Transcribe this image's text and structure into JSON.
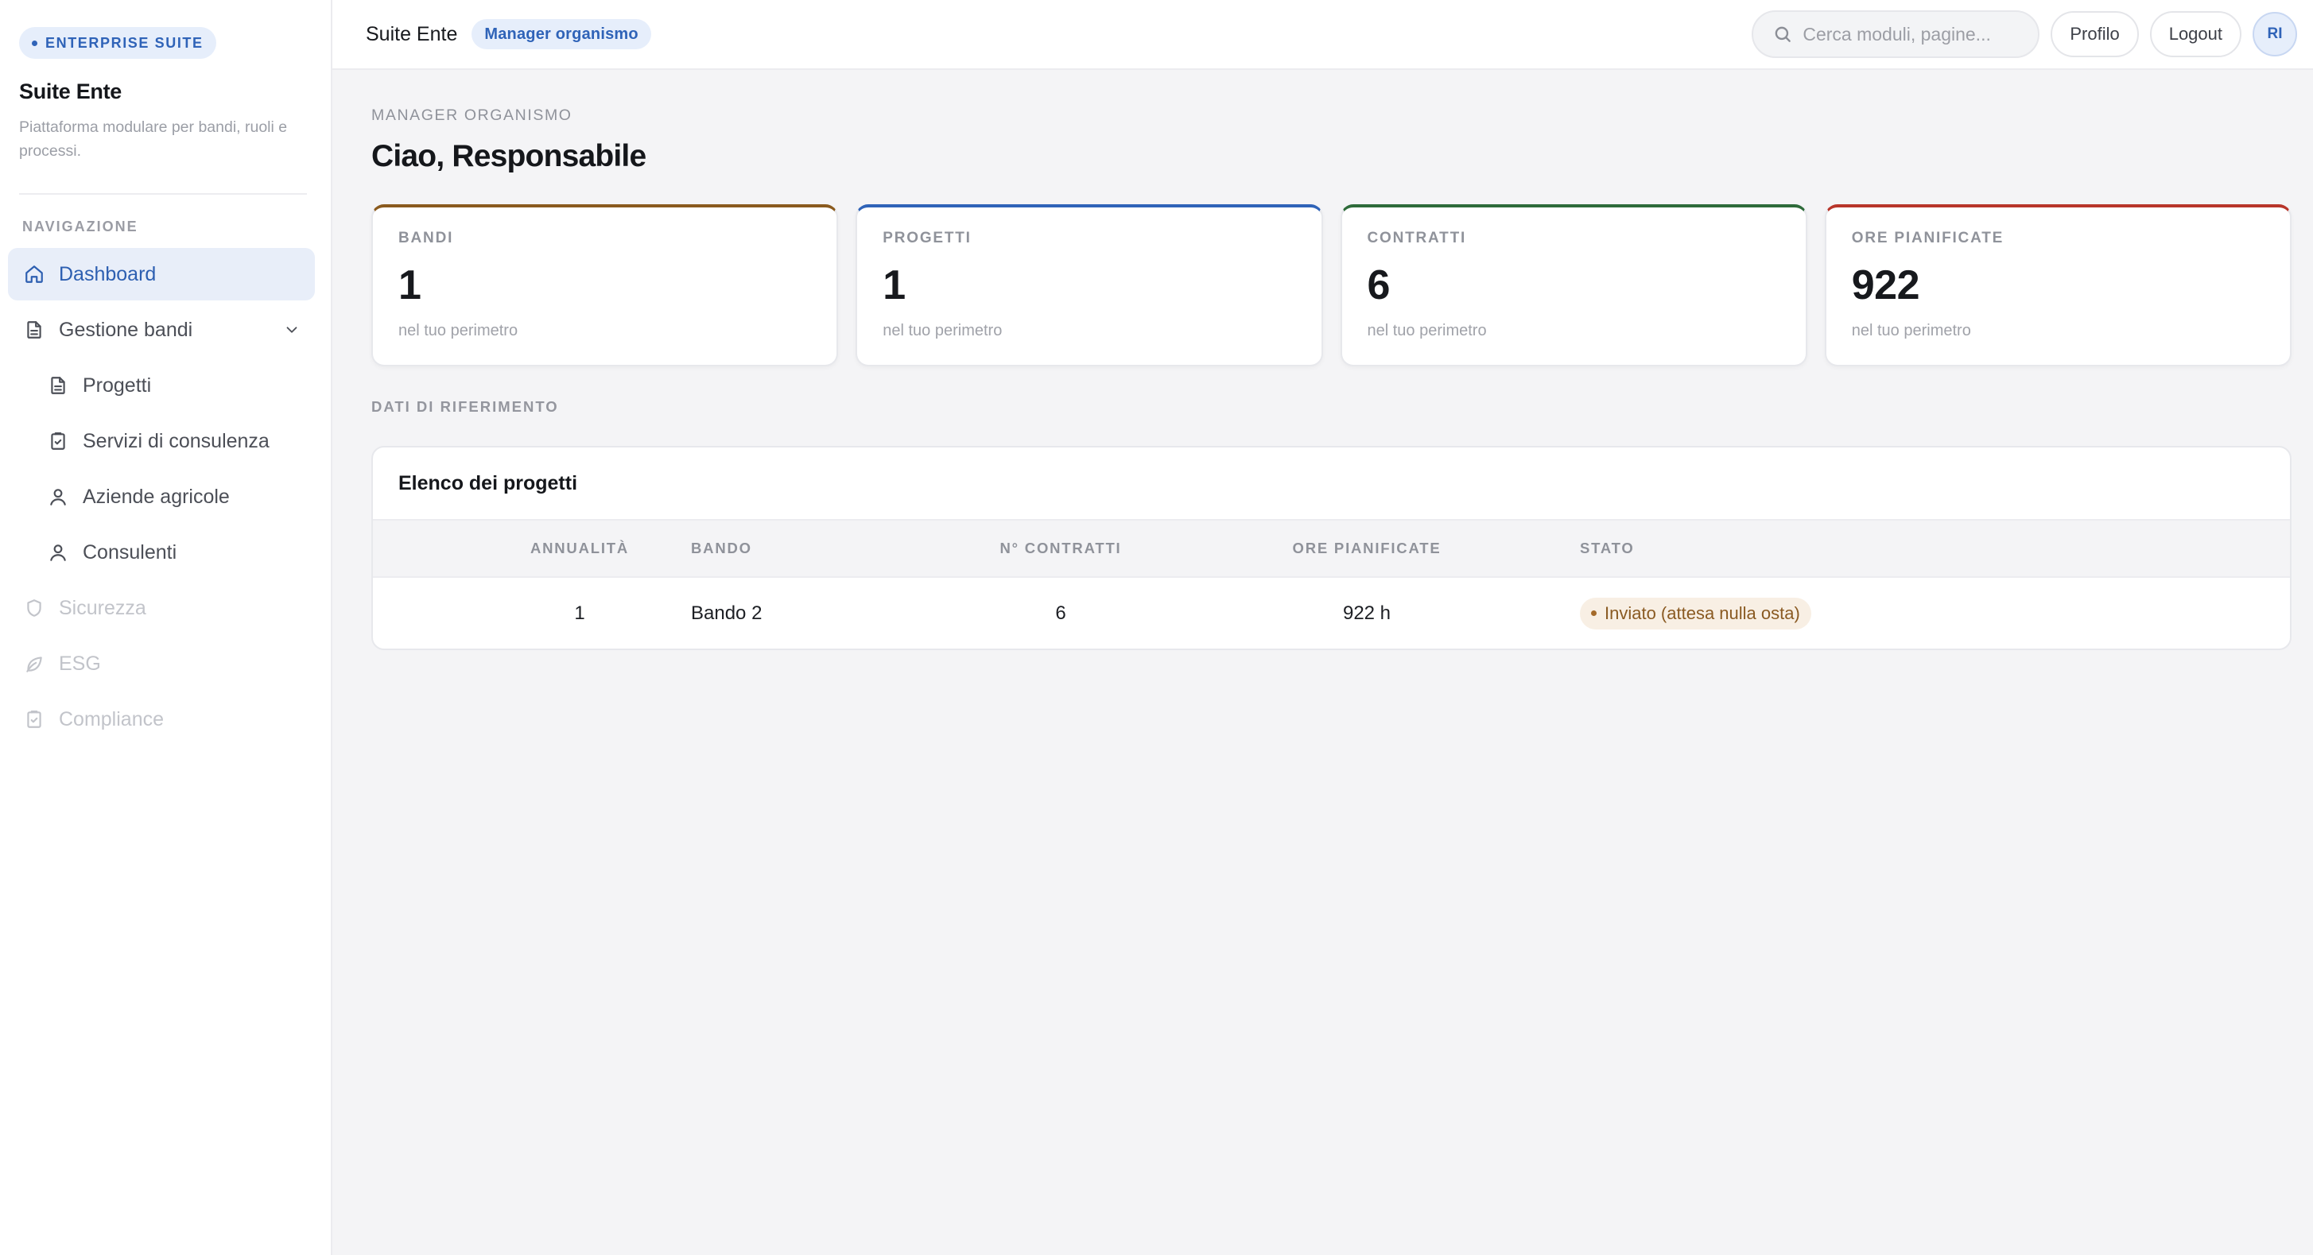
{
  "sidebar": {
    "suite_chip": "ENTERPRISE SUITE",
    "brand_title": "Suite Ente",
    "brand_desc": "Piattaforma modulare per bandi, ruoli e processi.",
    "nav_caption": "NAVIGAZIONE",
    "items": [
      {
        "label": "Dashboard",
        "icon": "home-icon",
        "state": "active"
      },
      {
        "label": "Gestione bandi",
        "icon": "document-icon",
        "state": "expanded"
      },
      {
        "label": "Progetti",
        "icon": "document-icon",
        "state": "sub"
      },
      {
        "label": "Servizi di consulenza",
        "icon": "clipboard-icon",
        "state": "sub"
      },
      {
        "label": "Aziende agricole",
        "icon": "user-icon",
        "state": "sub"
      },
      {
        "label": "Consulenti",
        "icon": "user-icon",
        "state": "sub"
      },
      {
        "label": "Sicurezza",
        "icon": "shield-icon",
        "state": "disabled"
      },
      {
        "label": "ESG",
        "icon": "leaf-icon",
        "state": "disabled"
      },
      {
        "label": "Compliance",
        "icon": "clipboard-icon",
        "state": "disabled"
      }
    ]
  },
  "topbar": {
    "title": "Suite Ente",
    "role_chip": "Manager organismo",
    "search_placeholder": "Cerca moduli, pagine...",
    "profile_label": "Profilo",
    "logout_label": "Logout",
    "avatar_initials": "RI"
  },
  "main": {
    "eyebrow": "MANAGER ORGANISMO",
    "greeting": "Ciao, Responsabile",
    "stats": [
      {
        "label": "BANDI",
        "value": "1",
        "sub": "nel tuo perimetro",
        "color": "#8a5a1e"
      },
      {
        "label": "PROGETTI",
        "value": "1",
        "sub": "nel tuo perimetro",
        "color": "#2f63b8"
      },
      {
        "label": "CONTRATTI",
        "value": "6",
        "sub": "nel tuo perimetro",
        "color": "#2e6b3a"
      },
      {
        "label": "ORE PIANIFICATE",
        "value": "922",
        "sub": "nel tuo perimetro",
        "color": "#b8352a"
      }
    ],
    "section_label": "DATI DI RIFERIMENTO",
    "table": {
      "title": "Elenco dei progetti",
      "columns": [
        "ANNUALITÀ",
        "BANDO",
        "N° CONTRATTI",
        "ORE PIANIFICATE",
        "STATO"
      ],
      "rows": [
        {
          "annualita": "1",
          "bando": "Bando 2",
          "contratti": "6",
          "ore": "922 h",
          "stato": "Inviato (attesa nulla osta)"
        }
      ]
    }
  }
}
